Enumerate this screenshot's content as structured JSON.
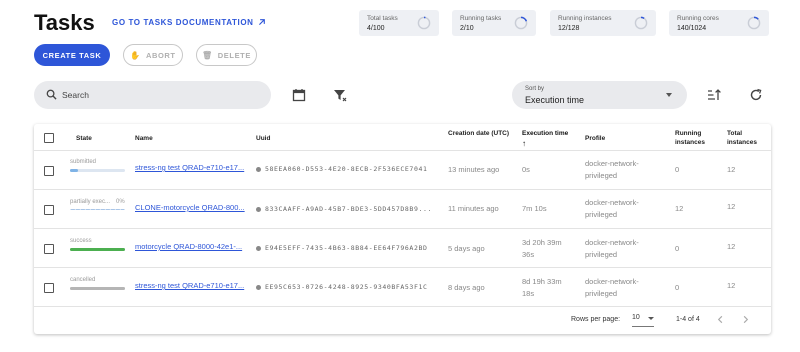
{
  "header": {
    "title": "Tasks",
    "doc_link": "GO TO TASKS DOCUMENTATION",
    "doc_link_icon": "external-link-icon"
  },
  "stats": [
    {
      "label": "Total tasks",
      "value": "4/100",
      "fraction": 0.04
    },
    {
      "label": "Running tasks",
      "value": "2/10",
      "fraction": 0.2
    },
    {
      "label": "Running instances",
      "value": "12/128",
      "fraction": 0.094
    },
    {
      "label": "Running cores",
      "value": "140/1024",
      "fraction": 0.137
    }
  ],
  "actions": {
    "create": "CREATE TASK",
    "abort": "ABORT",
    "delete": "DELETE"
  },
  "search": {
    "placeholder": "Search"
  },
  "sort": {
    "label": "Sort by",
    "value": "Execution time"
  },
  "table": {
    "headers": {
      "state": "State",
      "name": "Name",
      "uuid": "Uuid",
      "creation_date": "Creation date (UTC)",
      "execution_time": "Execution time",
      "execution_sort_arrow": "↑",
      "profile": "Profile",
      "running_instances": "Running instances",
      "total_instances": "Total instances"
    },
    "rows": [
      {
        "state": "submitted",
        "state_color": "#7fb3e6",
        "progress": 0.15,
        "name": "stress-ng test QRAD-e710-e17...",
        "uuid": "58EEA060-D553-4E20-8ECB-2F536ECE7041",
        "created": "13 minutes ago",
        "exec_line1": "0s",
        "exec_line2": "",
        "profile_line1": "docker-network-",
        "profile_line2": "privileged",
        "running": "0",
        "total": "12"
      },
      {
        "state": "partially exec...",
        "state_pct": "0%",
        "state_color": "#7fb3e6",
        "progress": 0,
        "name": "CLONE-motorcycle QRAD-800...",
        "uuid": "833CAAFF-A9AD-45B7-BDE3-5DD457D8B9...",
        "created": "11 minutes ago",
        "exec_line1": "7m 10s",
        "exec_line2": "",
        "profile_line1": "docker-network-",
        "profile_line2": "privileged",
        "running": "12",
        "total": "12"
      },
      {
        "state": "success",
        "state_color": "#4caf50",
        "progress": 1,
        "name": "motorcycle QRAD-8000-42e1-...",
        "uuid": "E94E5EFF-7435-4B63-8B84-EE64F796A2BD",
        "created": "5 days ago",
        "exec_line1": "3d 20h 39m",
        "exec_line2": "36s",
        "profile_line1": "docker-network-",
        "profile_line2": "privileged",
        "running": "0",
        "total": "12"
      },
      {
        "state": "cancelled",
        "state_color": "#b5b5b5",
        "progress": 1,
        "name": "stress-ng test QRAD-e710-e17...",
        "uuid": "EE95C653-0726-4248-8925-9340BFA53F1C",
        "created": "8 days ago",
        "exec_line1": "8d 19h 33m",
        "exec_line2": "18s",
        "profile_line1": "docker-network-",
        "profile_line2": "privileged",
        "running": "0",
        "total": "12"
      }
    ]
  },
  "pagination": {
    "rows_per_page_label": "Rows per page:",
    "rows_per_page": "10",
    "range": "1-4 of 4"
  }
}
